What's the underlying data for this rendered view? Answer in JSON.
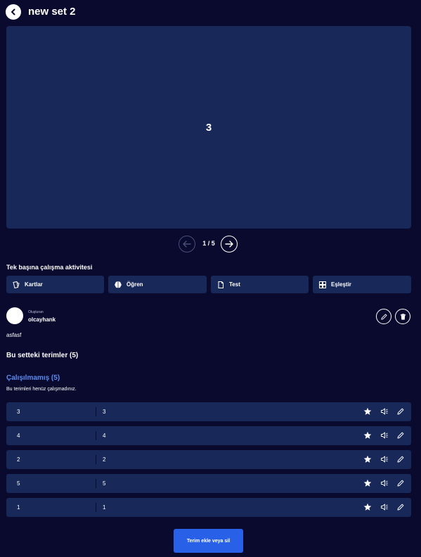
{
  "header": {
    "title": "new set 2",
    "back_icon": "chevron-left-icon"
  },
  "flashcard": {
    "text": "3"
  },
  "pager": {
    "label": "1 / 5",
    "prev_icon": "arrow-left-icon",
    "next_icon": "arrow-right-icon"
  },
  "activities": {
    "heading": "Tek başına çalışma aktivitesi",
    "items": [
      {
        "label": "Kartlar",
        "icon": "cards-icon"
      },
      {
        "label": "Öğren",
        "icon": "brain-icon"
      },
      {
        "label": "Test",
        "icon": "document-icon"
      },
      {
        "label": "Eşleştir",
        "icon": "match-icon"
      }
    ]
  },
  "creator": {
    "caption": "Oluşturan",
    "name": "olcayhank",
    "edit_icon": "pencil-icon",
    "delete_icon": "trash-icon"
  },
  "description": "asfasf",
  "terms": {
    "title": "Bu setteki terimler (5)",
    "group_title": "Çalışılmamış (5)",
    "group_note": "Bu terimleri henüz çalışmadınız.",
    "rows": [
      {
        "term": "3",
        "definition": "3"
      },
      {
        "term": "4",
        "definition": "4"
      },
      {
        "term": "2",
        "definition": "2"
      },
      {
        "term": "5",
        "definition": "5"
      },
      {
        "term": "1",
        "definition": "1"
      }
    ],
    "row_icons": [
      "star-icon",
      "speaker-icon",
      "pencil-icon"
    ]
  },
  "footer": {
    "add_button_label": "Terim ekle veya sil"
  },
  "colors": {
    "background": "#0a0a2f",
    "surface": "#182858",
    "accent": "#2860e8",
    "link": "#5b8cf0"
  }
}
